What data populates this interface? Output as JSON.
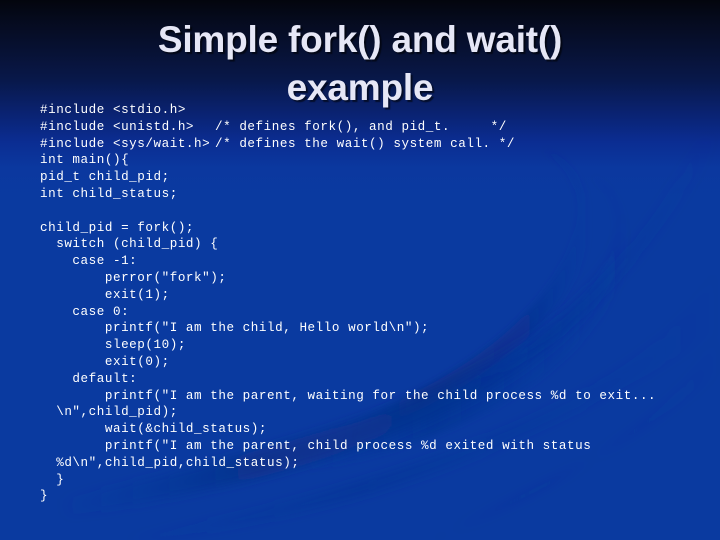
{
  "slide": {
    "title": "Simple fork() and wait()\nexample",
    "background": {
      "top_color": "#03050d",
      "bottom_color": "#0a3aa0",
      "decor_color": "#0b2f88"
    },
    "title_color": "#e6e7f6",
    "code_color": "#ffffff"
  },
  "code": {
    "language": "c",
    "lines": [
      {
        "text": "#include <stdio.h>",
        "comment": ""
      },
      {
        "text": "#include <unistd.h>",
        "comment": "/* defines fork(), and pid_t.     */"
      },
      {
        "text": "#include <sys/wait.h>",
        "comment": "/* defines the wait() system call. */"
      },
      {
        "text": "int main(){",
        "comment": ""
      },
      {
        "text": "pid_t child_pid;",
        "comment": ""
      },
      {
        "text": "int child_status;",
        "comment": ""
      },
      {
        "text": "",
        "comment": ""
      },
      {
        "text": "child_pid = fork();",
        "comment": ""
      },
      {
        "text": "  switch (child_pid) {",
        "comment": ""
      },
      {
        "text": "    case -1:",
        "comment": ""
      },
      {
        "text": "        perror(\"fork\");",
        "comment": ""
      },
      {
        "text": "        exit(1);",
        "comment": ""
      },
      {
        "text": "    case 0:",
        "comment": ""
      },
      {
        "text": "        printf(\"I am the child, Hello world\\n\");",
        "comment": ""
      },
      {
        "text": "        sleep(10);",
        "comment": ""
      },
      {
        "text": "        exit(0);",
        "comment": ""
      },
      {
        "text": "    default:",
        "comment": ""
      },
      {
        "text": "        printf(\"I am the parent, waiting for the child process %d to exit...",
        "comment": ""
      },
      {
        "text": "  \\n\",child_pid);",
        "comment": ""
      },
      {
        "text": "        wait(&child_status);",
        "comment": ""
      },
      {
        "text": "        printf(\"I am the parent, child process %d exited with status",
        "comment": ""
      },
      {
        "text": "  %d\\n\",child_pid,child_status);",
        "comment": ""
      },
      {
        "text": "  }",
        "comment": ""
      },
      {
        "text": "}",
        "comment": ""
      }
    ]
  }
}
